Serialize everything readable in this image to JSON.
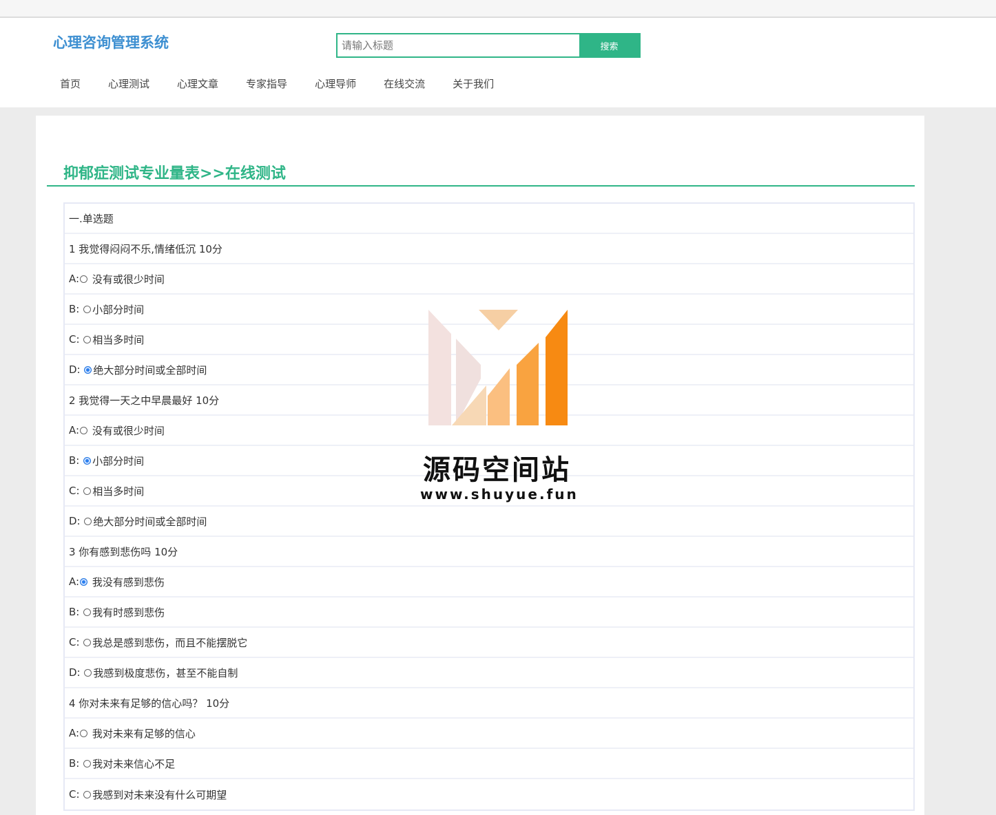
{
  "header": {
    "logo": "心理咨询管理系统",
    "search": {
      "placeholder": "请输入标题",
      "button_label": "搜索"
    }
  },
  "nav": [
    "首页",
    "心理测试",
    "心理文章",
    "专家指导",
    "心理导师",
    "在线交流",
    "关于我们"
  ],
  "page_title": "抑郁症测试专业量表>>在线测试",
  "quiz": {
    "section_title": "一.单选题",
    "rows": [
      {
        "type": "question",
        "text": "1 我觉得闷闷不乐,情绪低沉 10分"
      },
      {
        "type": "option",
        "prefix": "A:",
        "text": " 没有或很少时间",
        "checked": false
      },
      {
        "type": "option",
        "prefix": "B: ",
        "text": "小部分时间",
        "checked": false
      },
      {
        "type": "option",
        "prefix": "C: ",
        "text": "相当多时间",
        "checked": false
      },
      {
        "type": "option",
        "prefix": "D: ",
        "text": "绝大部分时间或全部时间",
        "checked": true
      },
      {
        "type": "question",
        "text": "2 我觉得一天之中早晨最好 10分"
      },
      {
        "type": "option",
        "prefix": "A:",
        "text": " 没有或很少时间",
        "checked": false
      },
      {
        "type": "option",
        "prefix": "B: ",
        "text": "小部分时间",
        "checked": true
      },
      {
        "type": "option",
        "prefix": "C: ",
        "text": "相当多时间",
        "checked": false
      },
      {
        "type": "option",
        "prefix": "D: ",
        "text": "绝大部分时间或全部时间",
        "checked": false
      },
      {
        "type": "question",
        "text": "3 你有感到悲伤吗 10分"
      },
      {
        "type": "option",
        "prefix": "A:",
        "text": " 我没有感到悲伤",
        "checked": true
      },
      {
        "type": "option",
        "prefix": "B: ",
        "text": "我有时感到悲伤",
        "checked": false
      },
      {
        "type": "option",
        "prefix": "C: ",
        "text": "我总是感到悲伤，而且不能摆脱它",
        "checked": false
      },
      {
        "type": "option",
        "prefix": "D: ",
        "text": "我感到极度悲伤，甚至不能自制",
        "checked": false
      },
      {
        "type": "question",
        "text": "4 你对未来有足够的信心吗？ 10分"
      },
      {
        "type": "option",
        "prefix": "A:",
        "text": " 我对未来有足够的信心",
        "checked": false
      },
      {
        "type": "option",
        "prefix": "B: ",
        "text": "我对未来信心不足",
        "checked": false
      },
      {
        "type": "option",
        "prefix": "C: ",
        "text": "我感到对未来没有什么可期望",
        "checked": false
      }
    ]
  },
  "watermark": {
    "name": "源码空间站",
    "url": "www.shuyue.fun"
  },
  "colors": {
    "accent": "#2fb587",
    "logo": "#3d8fd1",
    "radio_checked": "#2a7ff0"
  }
}
